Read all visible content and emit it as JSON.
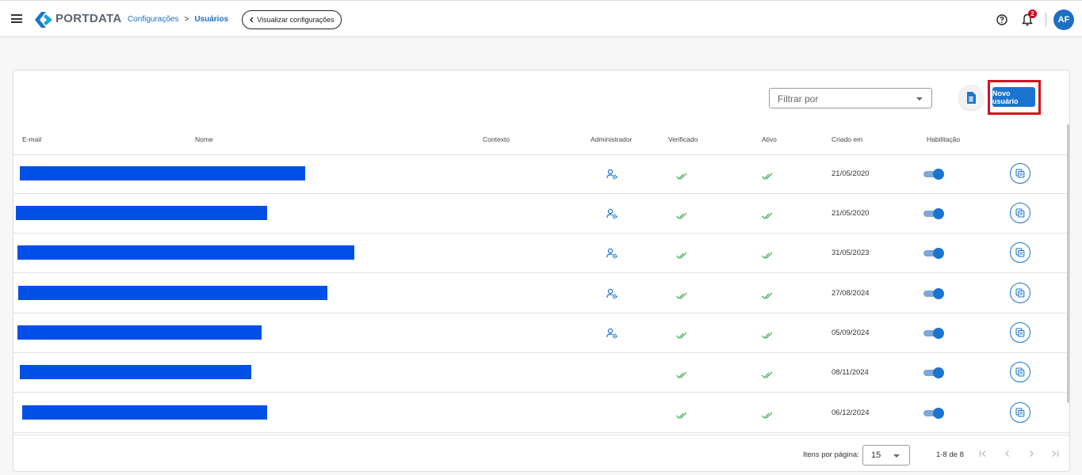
{
  "header": {
    "logo_text_a": "PORT",
    "logo_text_b": "DATA",
    "breadcrumb": [
      "Configurações",
      "Usuários"
    ],
    "breadcrumb_sep": ">",
    "view_config_label": "Visualizar configurações",
    "notification_count": "2",
    "avatar_initials": "AF"
  },
  "toolbar": {
    "filter_placeholder": "Filtrar por",
    "new_user_label": "Novo usuário"
  },
  "table": {
    "columns": [
      "E-mail",
      "Nome",
      "Contexto",
      "Administrador",
      "Verificado",
      "Ativo",
      "Criado em",
      "Habilitação"
    ],
    "rows": [
      {
        "admin": true,
        "verified": true,
        "active": true,
        "created": "21/05/2020",
        "enabled": true
      },
      {
        "admin": true,
        "verified": true,
        "active": true,
        "created": "21/05/2020",
        "enabled": true
      },
      {
        "admin": true,
        "verified": true,
        "active": true,
        "created": "31/05/2023",
        "enabled": true
      },
      {
        "admin": true,
        "verified": true,
        "active": true,
        "created": "27/08/2024",
        "enabled": true
      },
      {
        "admin": true,
        "verified": true,
        "active": true,
        "created": "05/09/2024",
        "enabled": true
      },
      {
        "admin": false,
        "verified": true,
        "active": true,
        "created": "08/11/2024",
        "enabled": true
      },
      {
        "admin": false,
        "verified": true,
        "active": true,
        "created": "06/12/2024",
        "enabled": true
      }
    ]
  },
  "pagination": {
    "items_per_page_label": "Itens por página:",
    "items_per_page": "15",
    "range": "1-8 de 8"
  },
  "colors": {
    "primary": "#1b75d0",
    "highlight": "#d4131c",
    "check": "#3aa655",
    "redaction": "#0050e8"
  }
}
